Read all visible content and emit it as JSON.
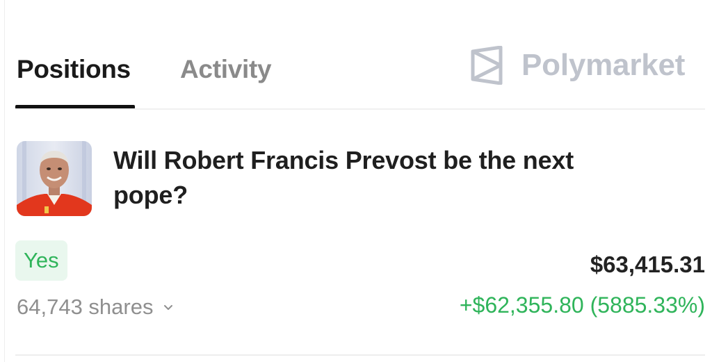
{
  "tabs": {
    "positions": "Positions",
    "activity": "Activity",
    "active": "Positions"
  },
  "brand": {
    "name": "Polymarket",
    "icon": "polymarket-logo-icon",
    "color": "#bfc3cc"
  },
  "position": {
    "thumbnail": "market-avatar-image",
    "market_title": "Will Robert Francis Prevost be the next pope?",
    "outcome": "Yes",
    "shares": "64,743 shares",
    "shares_icon": "chevron-down-icon",
    "value": "$63,415.31",
    "pnl": "+$62,355.80 (5885.33%)"
  },
  "colors": {
    "positive": "#2fb45a",
    "positive_bg": "#e9f7ee",
    "text_primary": "#1f1f1f",
    "text_muted": "#8f8f8f",
    "tab_underline": "#111111"
  }
}
